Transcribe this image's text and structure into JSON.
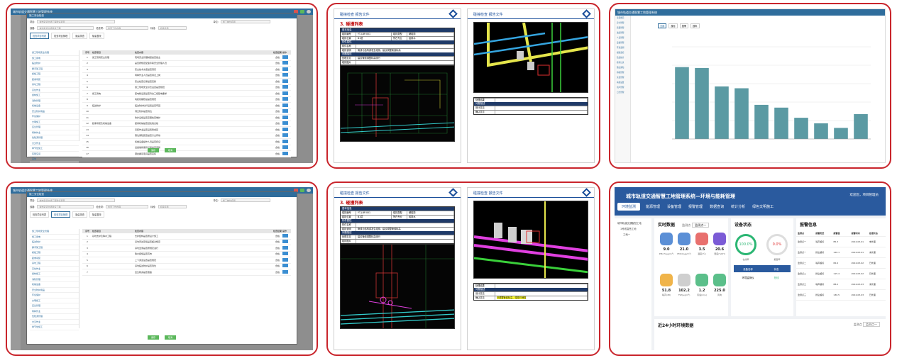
{
  "app": {
    "window_title": "城市轨道交通智慧工地管理系统",
    "modal_title": "施工安全检查",
    "form": {
      "project_label": "项目:",
      "project_value": "城市轨道交通工程建设项目",
      "line_label": "线路:",
      "line_value": "城市轨道交通建设工程",
      "section_label": "标段:",
      "section_value": "标段名称",
      "unit_label": "单位:",
      "unit_value": "施工单位名称",
      "check_label": "检查项:",
      "check_value": "检查工作内容"
    },
    "tabs": [
      "检查项目列表",
      "检查项目管理",
      "隐患排查",
      "隐患整改"
    ],
    "table_headers": [
      "序号",
      "检查项目",
      "检查内容",
      "检查结果",
      "操作"
    ],
    "footer_buttons": [
      "保存",
      "取消"
    ]
  },
  "panel1": {
    "tree": [
      "施工现场安全管理",
      "施工用电",
      "临边防护",
      "脚手架工程",
      "模板工程",
      "起重吊装",
      "基坑工程",
      "高处作业",
      "盾构施工",
      "消防管理",
      "机械设备",
      "安全防护用品",
      "环境保护",
      "文明施工",
      "应急管理",
      "特种作业",
      "危险源管理",
      "交叉作业",
      "季节性施工",
      "有限空间",
      "其他"
    ],
    "rows": [
      {
        "no": "1",
        "item": "施工现场安全管理",
        "content": "现场安全管理制度是否健全",
        "result": "合格"
      },
      {
        "no": "2",
        "item": "",
        "content": "是否按规定配备专职安全管理人员",
        "result": "合格"
      },
      {
        "no": "3",
        "item": "",
        "content": "安全技术交底是否落实",
        "result": "合格"
      },
      {
        "no": "4",
        "item": "",
        "content": "特种作业人员是否持证上岗",
        "result": "合格"
      },
      {
        "no": "5",
        "item": "",
        "content": "安全检查记录是否完整",
        "result": "合格"
      },
      {
        "no": "6",
        "item": "",
        "content": "施工现场安全标志设置是否规范",
        "result": "合格"
      },
      {
        "no": "7",
        "item": "施工用电",
        "content": "配电箱设置是否符合三级配电要求",
        "result": "合格"
      },
      {
        "no": "8",
        "item": "",
        "content": "电缆线路敷设是否规范",
        "result": "合格"
      },
      {
        "no": "9",
        "item": "临边防护",
        "content": "临边防护栏杆设置是否牢固",
        "result": "合格"
      },
      {
        "no": "10",
        "item": "",
        "content": "洞口防护是否到位",
        "result": "合格"
      },
      {
        "no": "11",
        "item": "",
        "content": "防护设施是否定期检查维护",
        "result": "合格"
      },
      {
        "no": "12",
        "item": "起重吊装及机械设备",
        "content": "起重机械是否经检验合格",
        "result": "合格"
      },
      {
        "no": "13",
        "item": "",
        "content": "吊装作业是否设置警戒区",
        "result": "合格"
      },
      {
        "no": "14",
        "item": "",
        "content": "限位保险装置是否齐全有效",
        "result": "合格"
      },
      {
        "no": "15",
        "item": "",
        "content": "机械设备操作人员是否持证",
        "result": "合格"
      },
      {
        "no": "16",
        "item": "",
        "content": "设备维修保养记录是否完整",
        "result": "合格"
      },
      {
        "no": "17",
        "item": "",
        "content": "钢丝绳吊索具是否完好",
        "result": "合格"
      }
    ]
  },
  "panel4": {
    "tree": [
      "施工现场安全管理",
      "施工用电",
      "临边防护",
      "脚手架工程",
      "模板工程",
      "起重吊装",
      "基坑工程",
      "高处作业",
      "盾构施工",
      "消防管理",
      "机械设备",
      "安全防护用品",
      "环境保护",
      "文明施工",
      "应急管理",
      "特种作业",
      "危险源管理",
      "交叉作业",
      "季节性施工"
    ],
    "rows": [
      {
        "no": "1",
        "item": "基坑支护及降水工程",
        "content": "支护结构是否按设计施工",
        "result": "合格"
      },
      {
        "no": "2",
        "item": "",
        "content": "基坑周边荷载是否超过规定",
        "result": "合格"
      },
      {
        "no": "3",
        "item": "",
        "content": "基坑监测是否按规定进行",
        "result": "合格"
      },
      {
        "no": "4",
        "item": "",
        "content": "降水措施是否有效",
        "result": "合格"
      },
      {
        "no": "5",
        "item": "",
        "content": "上下通道设置是否规范",
        "result": "合格"
      },
      {
        "no": "6",
        "item": "",
        "content": "基坑临边防护是否到位",
        "result": "合格"
      },
      {
        "no": "7",
        "item": "",
        "content": "应急物资是否准备",
        "result": "合格"
      }
    ]
  },
  "doc": {
    "header": "碰撞检查  报告文件",
    "title": "3. 碰撞列表",
    "section_basic": "基本信息",
    "section_attr": "构件属性",
    "section_desc": "问题描述",
    "section_img": "碰撞图片",
    "label_id": "碰撞编号",
    "value_id": "YT-J-BP-001",
    "label_type": "碰撞类型",
    "value_type": "硬碰撞",
    "label_pos": "碰撞位置",
    "value_pos": "B1层",
    "label_level": "所在专业",
    "value_level": "给排水",
    "label_comp": "构件名称",
    "label_desc": "碰撞说明",
    "value_desc": "管线与结构梁发生碰撞，建议调整管线标高",
    "label_fix": "处理意见",
    "value_fix": "建议管线调整标高绕行",
    "label_result": "处理结果",
    "label_opinion": "设计意见",
    "label_confirm": "确认意见",
    "value_confirm_p5": "已调整管线标高，碰撞已消除"
  },
  "chart_data": {
    "type": "bar",
    "title": "",
    "categories": [
      "",
      "",
      "",
      "",
      "",
      "",
      "",
      "",
      "",
      ""
    ],
    "values": [
      78,
      77,
      57,
      55,
      37,
      34,
      23,
      17,
      12,
      27
    ],
    "ylim": [
      0,
      100
    ],
    "legend_position": "top",
    "bar_color": "#5b9aa3",
    "grid": true
  },
  "chart_panel": {
    "window_title": "城市轨道交通智慧工地管理系统",
    "tabs": [
      "全部",
      "按月",
      "按季",
      "按年"
    ],
    "sidebar_items": [
      "项目概况",
      "安全管理",
      "质量管理",
      "进度管理",
      "人员管理",
      "设备管理",
      "环境监测",
      "视频监控",
      "隐患统计",
      "检查记录",
      "整改通知",
      "验收管理",
      "文档管理",
      "系统设置",
      "用户管理",
      "日志管理"
    ]
  },
  "dashboard": {
    "title": "城市轨道交通智慧工地管理系统—环境与能耗管理",
    "user": "欢迎您，项目管理员",
    "nav": [
      "环境监测",
      "能源管理",
      "设备管理",
      "报警管理",
      "数据查询",
      "统计分析",
      "绿色文明施工"
    ],
    "tree_root": "城市轨道交通智慧工地",
    "tree_child1": "1号线智慧工地",
    "tree_child2": "工地一",
    "realtime_title": "实时数据",
    "select_label": "监测点",
    "select_value": "监测点一",
    "device_title": "设备状态",
    "alarm_title": "报警信息",
    "trend_title": "近24小时环境数据",
    "sensors": [
      {
        "value": "9.0",
        "label": "PM2.5(μg/m³)"
      },
      {
        "value": "21.0",
        "label": "PM10(μg/m³)"
      },
      {
        "value": "3.5",
        "label": "温度(℃)"
      },
      {
        "value": "20.6",
        "label": "湿度(%RH)"
      },
      {
        "value": "51.8",
        "label": "噪声(dB)"
      },
      {
        "value": "102.2",
        "label": "TSP(μg/m³)"
      },
      {
        "value": "1.2",
        "label": "风速(m/s)"
      },
      {
        "value": "225.0",
        "label": "风向"
      }
    ],
    "gauge_online": "100.0%",
    "gauge_online_label": "在线率",
    "gauge_alarm": "0.0%",
    "gauge_alarm_label": "报警率",
    "device_col1": "设备名称",
    "device_col2": "状态",
    "device_name": "环境监测仪",
    "device_status": "在线",
    "alarm_headers": [
      "监测点",
      "报警类型",
      "报警值",
      "报警时间",
      "处理状态"
    ],
    "alarms": [
      {
        "point": "监测点一",
        "type": "噪声超标",
        "value": "85.3",
        "time": "2024-03-01",
        "state": "未处理"
      },
      {
        "point": "监测点一",
        "type": "扬尘超标",
        "value": "120.1",
        "time": "2024-03-01",
        "state": "未处理"
      },
      {
        "point": "监测点二",
        "type": "噪声超标",
        "value": "82.6",
        "time": "2024-03-02",
        "state": "已处理"
      },
      {
        "point": "监测点二",
        "type": "扬尘超标",
        "value": "115.4",
        "time": "2024-03-02",
        "state": "已处理"
      },
      {
        "point": "监测点三",
        "type": "噪声超标",
        "value": "88.0",
        "time": "2024-03-03",
        "state": "未处理"
      },
      {
        "point": "监测点三",
        "type": "扬尘超标",
        "value": "130.5",
        "time": "2024-03-03",
        "state": "已处理"
      }
    ]
  },
  "colors": {
    "frame": "#c9252c",
    "brand": "#2f6d9c",
    "dash_brand": "#2a5a9e",
    "doc_blue": "#1f3a68"
  }
}
